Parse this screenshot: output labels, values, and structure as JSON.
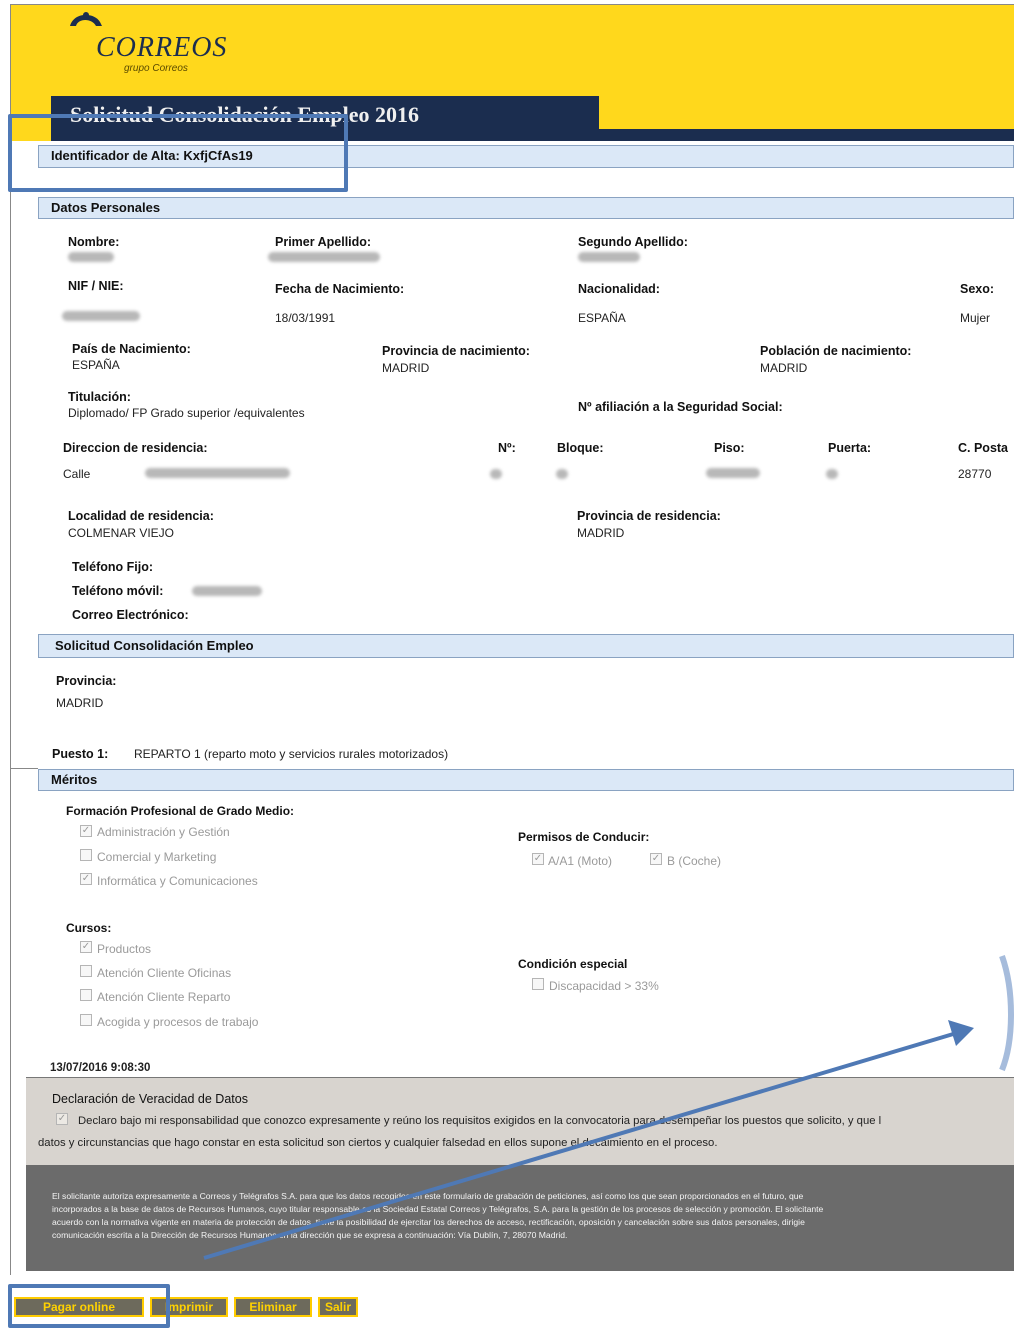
{
  "header": {
    "brand": "CORREOS",
    "brand_sub": "grupo Correos",
    "title": "Solicitud Consolidación Empleo 2016",
    "identifier": "Identificador de Alta: KxfjCfAs19"
  },
  "personal": {
    "section": "Datos Personales",
    "nombre_label": "Nombre:",
    "apellido1_label": "Primer Apellido:",
    "apellido2_label": "Segundo Apellido:",
    "nif_label": "NIF / NIE:",
    "fecha_label": "Fecha de Nacimiento:",
    "fecha_value": "18/03/1991",
    "nacionalidad_label": "Nacionalidad:",
    "nacionalidad_value": "ESPAÑA",
    "sexo_label": "Sexo:",
    "sexo_value": "Mujer",
    "pais_label": "País de Nacimiento:",
    "pais_value": "ESPAÑA",
    "prov_nac_label": "Provincia de nacimiento:",
    "prov_nac_value": "MADRID",
    "pob_nac_label": "Población de nacimiento:",
    "pob_nac_value": "MADRID",
    "titulacion_label": "Titulación:",
    "titulacion_value": "Diplomado/ FP Grado superior /equivalentes",
    "afiliacion_label": "Nº afiliación a la Seguridad Social:",
    "direccion_label": "Direccion de residencia:",
    "direccion_value": "Calle",
    "numero_label": "Nº:",
    "bloque_label": "Bloque:",
    "piso_label": "Piso:",
    "puerta_label": "Puerta:",
    "cp_label": "C. Posta",
    "cp_value": "28770",
    "localidad_label": "Localidad de residencia:",
    "localidad_value": "COLMENAR VIEJO",
    "prov_res_label": "Provincia de residencia:",
    "prov_res_value": "MADRID",
    "tel_fijo_label": "Teléfono Fijo:",
    "tel_movil_label": "Teléfono móvil:",
    "email_label": "Correo Electrónico:"
  },
  "solicitud": {
    "section": "Solicitud Consolidación Empleo",
    "provincia_label": "Provincia:",
    "provincia_value": "MADRID",
    "puesto_label": "Puesto 1:",
    "puesto_value": "REPARTO 1 (reparto moto y servicios rurales motorizados)"
  },
  "meritos": {
    "section": "Méritos",
    "fp_label": "Formación Profesional de Grado Medio:",
    "fp_items": [
      {
        "label": "Administración y Gestión",
        "checked": true
      },
      {
        "label": "Comercial y Marketing",
        "checked": false
      },
      {
        "label": "Informática y Comunicaciones",
        "checked": true
      }
    ],
    "permisos_label": "Permisos de Conducir:",
    "permisos_items": [
      {
        "label": "A/A1 (Moto)",
        "checked": true
      },
      {
        "label": "B (Coche)",
        "checked": true
      }
    ],
    "cursos_label": "Cursos:",
    "cursos_items": [
      {
        "label": "Productos",
        "checked": true
      },
      {
        "label": "Atención Cliente Oficinas",
        "checked": false
      },
      {
        "label": "Atención Cliente Reparto",
        "checked": false
      },
      {
        "label": "Acogida y procesos de trabajo",
        "checked": false
      }
    ],
    "condicion_label": "Condición especial",
    "condicion_item": {
      "label": "Discapacidad > 33%",
      "checked": false
    },
    "timestamp": "13/07/2016 9:08:30"
  },
  "declaracion": {
    "title": "Declaración de Veracidad de Datos",
    "line1": "Declaro bajo mi responsabilidad que conozco expresamente y reúno los requisitos exigidos en la convocatoria para desempeñar los puestos que solicito, y que l",
    "line2": "datos y circunstancias que hago constar en esta solicitud son ciertos y cualquier falsedad en ellos supone el decaimiento en el proceso."
  },
  "legal": {
    "line1": "El solicitante autoriza expresamente a Correos y Telégrafos S.A. para que los datos recogidos en este formulario de grabación de peticiones, así como los que sean proporcionados en el futuro, que",
    "line2": "incorporados a la base de datos de Recursos Humanos, cuyo titular responsable es la Sociedad Estatal Correos y Telégrafos, S.A. para la gestión de los procesos de selección y promoción. El solicitante",
    "line3": "acuerdo con la normativa vigente en materia de protección de datos, tiene la posibilidad de ejercitar los derechos de acceso, rectificación, oposición y cancelación sobre sus datos personales, dirigie",
    "line4": "comunicación escrita a la Dirección de Recursos Humanos en la dirección que se expresa a continuación: Vía Dublín, 7, 28070 Madrid."
  },
  "buttons": {
    "pagar": "Pagar online",
    "imprimir": "Imprimir",
    "eliminar": "Eliminar",
    "salir": "Salir"
  },
  "colors": {
    "brand_yellow": "#ffd81c",
    "brand_navy": "#1b2d4f",
    "section_bar": "#dbe8f7",
    "annotation_blue": "#4f79b5"
  }
}
